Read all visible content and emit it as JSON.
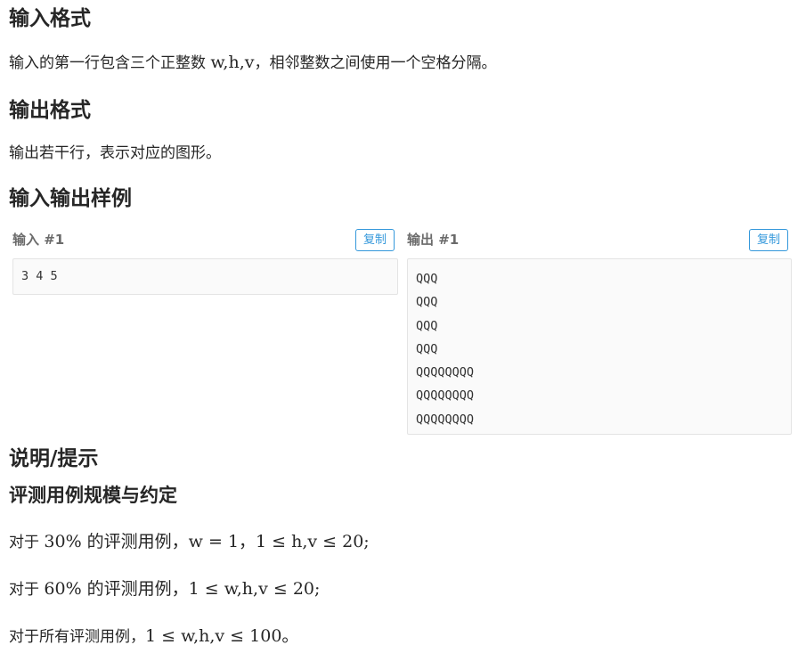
{
  "input_format": {
    "heading": "输入格式",
    "text_before": "输入的第一行包含三个正整数 ",
    "math": "w,h,v",
    "text_after": "，相邻整数之间使用一个空格分隔。"
  },
  "output_format": {
    "heading": "输出格式",
    "text": "输出若干行，表示对应的图形。"
  },
  "samples": {
    "heading": "输入输出样例",
    "input": {
      "label": "输入 #1",
      "copy_label": "复制",
      "lines": [
        "3 4 5"
      ]
    },
    "output": {
      "label": "输出 #1",
      "copy_label": "复制",
      "lines": [
        "QQQ",
        "QQQ",
        "QQQ",
        "QQQ",
        "QQQQQQQQ",
        "QQQQQQQQ",
        "QQQQQQQQ"
      ]
    }
  },
  "hint": {
    "heading": "说明/提示",
    "subheading": "评测用例规模与约定",
    "rows": [
      {
        "prefix": "对于 ",
        "math": "30% 的评测用例，w = 1，1 ≤ h,v ≤ 20;"
      },
      {
        "prefix": "对于 ",
        "math": "60% 的评测用例，1 ≤ w,h,v ≤ 20;"
      },
      {
        "prefix": "对于所有评测用例，",
        "math": "1 ≤ w,h,v ≤ 100。"
      }
    ]
  }
}
